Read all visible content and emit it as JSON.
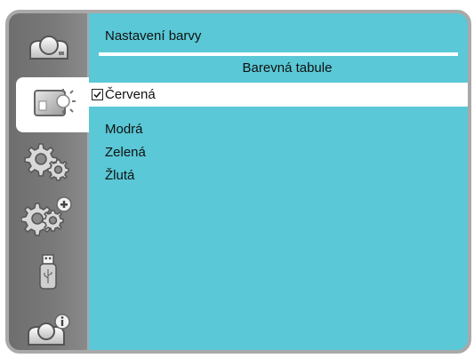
{
  "menu": {
    "title": "Nastavení barvy",
    "section": "Barevná tabule",
    "options": [
      {
        "label": "Červená",
        "checked": true
      },
      {
        "label": "Modrá",
        "checked": false
      },
      {
        "label": "Zelená",
        "checked": false
      },
      {
        "label": "Žlutá",
        "checked": false
      }
    ]
  },
  "sidebar": {
    "items": [
      {
        "icon": "projector-icon",
        "active": false
      },
      {
        "icon": "display-settings-icon",
        "active": true
      },
      {
        "icon": "settings-gears-icon",
        "active": false
      },
      {
        "icon": "advanced-settings-icon",
        "active": false
      },
      {
        "icon": "usb-drive-icon",
        "active": false
      },
      {
        "icon": "projector-info-icon",
        "active": false
      }
    ]
  },
  "colors": {
    "panel": "#5ac8d6",
    "sidebar": "#7a7a7a",
    "frame": "#a9a9a9"
  }
}
